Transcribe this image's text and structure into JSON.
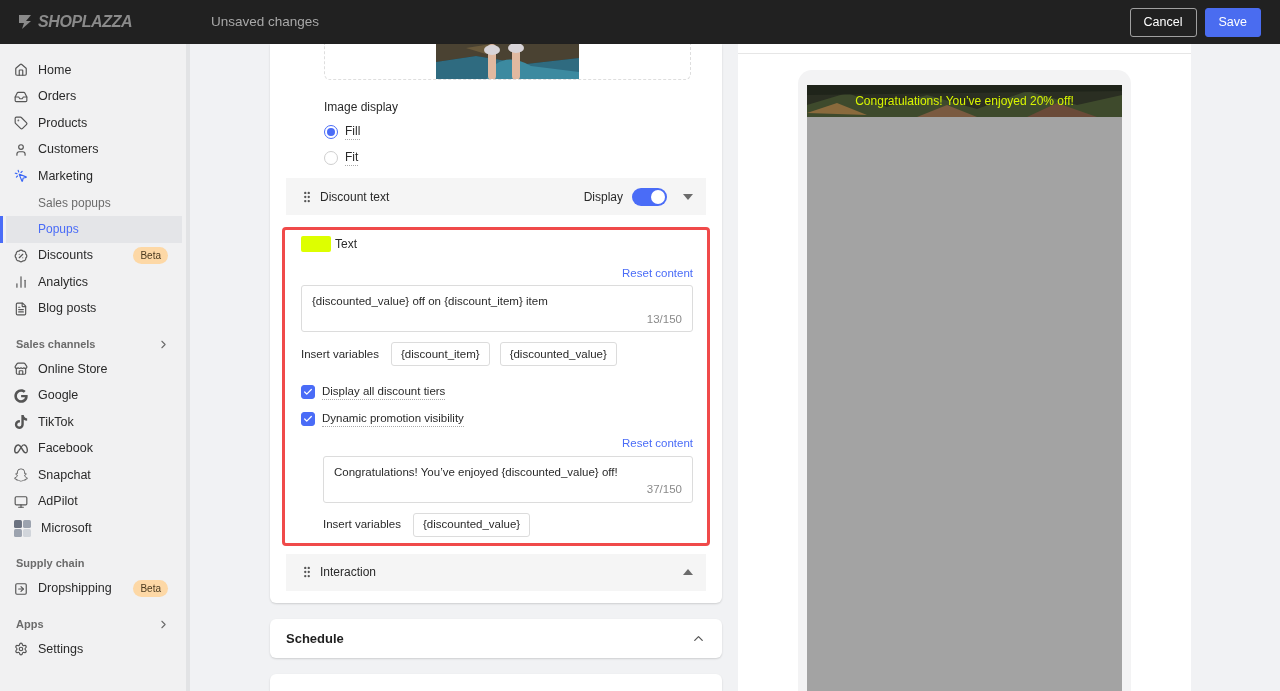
{
  "topbar": {
    "logo": "SHOPLAZZA",
    "status": "Unsaved changes",
    "buttons": [
      {
        "label": "Cancel",
        "kind": "secondary"
      },
      {
        "label": "Save",
        "kind": "primary"
      }
    ]
  },
  "sidebar": {
    "items": [
      {
        "kind": "item",
        "label": "Home",
        "selected": false
      },
      {
        "kind": "item",
        "label": "Orders",
        "selected": false
      },
      {
        "kind": "item",
        "label": "Products",
        "selected": false
      },
      {
        "kind": "item",
        "label": "Customers",
        "selected": false
      },
      {
        "kind": "item",
        "label": "Marketing",
        "selected": false
      },
      {
        "kind": "subitem",
        "label": "Sales popups",
        "selected": false
      },
      {
        "kind": "subitem",
        "label": "Popups",
        "selected": true
      },
      {
        "kind": "item",
        "label": "Discounts",
        "selected": false,
        "badge": "Beta"
      },
      {
        "kind": "item",
        "label": "Analytics",
        "selected": false
      },
      {
        "kind": "item",
        "label": "Blog posts",
        "selected": false
      },
      {
        "kind": "section",
        "label": "Sales channels",
        "collapsible": true
      },
      {
        "kind": "item",
        "label": "Online Store",
        "selected": false
      },
      {
        "kind": "item",
        "label": "Google",
        "selected": false
      },
      {
        "kind": "item",
        "label": "TikTok",
        "selected": false
      },
      {
        "kind": "item",
        "label": "Facebook",
        "selected": false
      },
      {
        "kind": "item",
        "label": "Snapchat",
        "selected": false
      },
      {
        "kind": "item",
        "label": "AdPilot",
        "selected": false
      },
      {
        "kind": "item",
        "label": "Microsoft",
        "selected": false
      },
      {
        "kind": "section",
        "label": "Supply chain",
        "collapsible": false
      },
      {
        "kind": "item",
        "label": "Dropshipping",
        "selected": false,
        "badge": "Beta"
      },
      {
        "kind": "section",
        "label": "Apps",
        "collapsible": true
      },
      {
        "kind": "item",
        "label": "Settings",
        "selected": false
      }
    ]
  },
  "editor": {
    "image_display": {
      "label": "Image display",
      "options": [
        {
          "label": "Fill",
          "selected": true
        },
        {
          "label": "Fit",
          "selected": false
        }
      ]
    },
    "discount_text": {
      "title": "Discount text",
      "display_label": "Display",
      "on": true,
      "expanded": true
    },
    "text_settings": {
      "color": "#ddff00",
      "label": "Text",
      "reset": "Reset content",
      "value": "{discounted_value} off on {discount_item} item",
      "counter": "13/150",
      "insert_label": "Insert variables",
      "variables": [
        "{discount_item}",
        "{discounted_value}"
      ],
      "checkboxes": [
        {
          "label": "Display all discount tiers",
          "checked": true
        },
        {
          "label": "Dynamic promotion visibility",
          "checked": true
        }
      ],
      "reset_2": "Reset content",
      "value_2": "Congratulations! You’ve enjoyed {discounted_value} off!",
      "counter_2": "37/150",
      "insert_label_2": "Insert variables",
      "variables_2": [
        "{discounted_value}"
      ]
    },
    "interaction": {
      "title": "Interaction",
      "expanded": false
    },
    "schedule": {
      "title": "Schedule",
      "expanded": false
    }
  },
  "preview": {
    "banner": "Congratulations! You’ve enjoyed 20% off!"
  }
}
